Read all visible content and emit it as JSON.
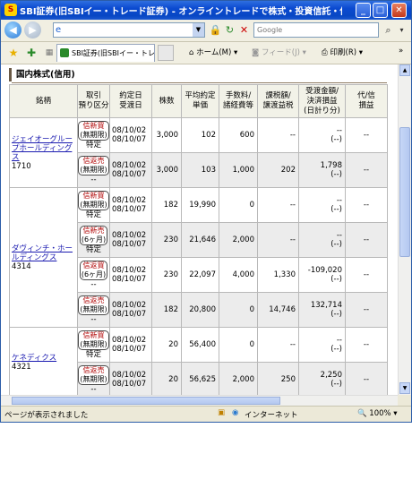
{
  "window": {
    "title": "SBI証券(旧SBIイー・トレード証券) - オンライントレードで株式・投資信託・債券を - - Wi...",
    "minimize": "_",
    "maximize": "□",
    "close": "✕"
  },
  "address_bar": {
    "url": "",
    "search_placeholder": "Google",
    "back": "◀",
    "forward": "▶"
  },
  "favorites_bar": {
    "tab_label": "SBI証券(旧SBIイー・トレー...",
    "home": "ホーム(M)",
    "feed": "フィード(J)",
    "print": "印刷(R)",
    "more": "»"
  },
  "section_title": "国内株式(信用)",
  "table": {
    "headers": [
      "銘柄",
      "取引\n預り区分",
      "約定日\n受渡日",
      "株数",
      "平均約定\n単価",
      "手数料/\n諸経費等",
      "課税額/\n譲渡益税",
      "受渡金額/\n決済損益\n(日計り分)",
      "代/信\n損益"
    ],
    "groups": [
      {
        "name": "ジェイオーグループホールディングス",
        "code": "1710",
        "rows": [
          {
            "tag_a": "信新買",
            "tag_b": "(無期限)",
            "custody": "特定",
            "trade_date": "08/10/02",
            "settle_date": "08/10/07",
            "qty": "3,000",
            "price": "102",
            "fee": "600",
            "tax": "--",
            "amount": "--",
            "pl": "(--)",
            "extra": "--"
          },
          {
            "tag_a": "信返売",
            "tag_b": "(無期限)",
            "custody": "--",
            "trade_date": "08/10/02",
            "settle_date": "08/10/07",
            "qty": "3,000",
            "price": "103",
            "fee": "1,000",
            "tax": "202",
            "amount": "1,798",
            "pl": "(--)",
            "extra": "--"
          }
        ]
      },
      {
        "name": "ダヴィンチ・ホールディングス",
        "code": "4314",
        "rows": [
          {
            "tag_a": "信新買",
            "tag_b": "(無期限)",
            "custody": "特定",
            "trade_date": "08/10/02",
            "settle_date": "08/10/07",
            "qty": "182",
            "price": "19,990",
            "fee": "0",
            "tax": "--",
            "amount": "--",
            "pl": "(--)",
            "extra": "--"
          },
          {
            "tag_a": "信新売",
            "tag_b": "(6ヶ月)",
            "custody": "特定",
            "trade_date": "08/10/02",
            "settle_date": "08/10/07",
            "qty": "230",
            "price": "21,646",
            "fee": "2,000",
            "tax": "--",
            "amount": "--",
            "pl": "(--)",
            "extra": "--"
          },
          {
            "tag_a": "信返買",
            "tag_b": "(6ヶ月)",
            "custody": "--",
            "trade_date": "08/10/02",
            "settle_date": "08/10/07",
            "qty": "230",
            "price": "22,097",
            "fee": "4,000",
            "tax": "1,330",
            "amount": "-109,020",
            "pl": "(--)",
            "extra": "--"
          },
          {
            "tag_a": "信返売",
            "tag_b": "(無期限)",
            "custody": "--",
            "trade_date": "08/10/02",
            "settle_date": "08/10/07",
            "qty": "182",
            "price": "20,800",
            "fee": "0",
            "tax": "14,746",
            "amount": "132,714",
            "pl": "(--)",
            "extra": "--"
          }
        ]
      },
      {
        "name": "ケネディクス",
        "code": "4321",
        "rows": [
          {
            "tag_a": "信新買",
            "tag_b": "(無期限)",
            "custody": "特定",
            "trade_date": "08/10/02",
            "settle_date": "08/10/07",
            "qty": "20",
            "price": "56,400",
            "fee": "0",
            "tax": "--",
            "amount": "--",
            "pl": "(--)",
            "extra": "--"
          },
          {
            "tag_a": "信返売",
            "tag_b": "(無期限)",
            "custody": "--",
            "trade_date": "08/10/02",
            "settle_date": "08/10/07",
            "qty": "20",
            "price": "56,625",
            "fee": "2,000",
            "tax": "250",
            "amount": "2,250",
            "pl": "(--)",
            "extra": "--"
          }
        ]
      }
    ]
  },
  "status_bar": {
    "text": "ページが表示されました",
    "zone": "インターネット",
    "zoom": "100%"
  },
  "colors": {
    "title_bar": "#0b4ad0",
    "link": "#1a1ab0",
    "tag_text": "#b00000",
    "header_bg": "#f2f2e8"
  }
}
